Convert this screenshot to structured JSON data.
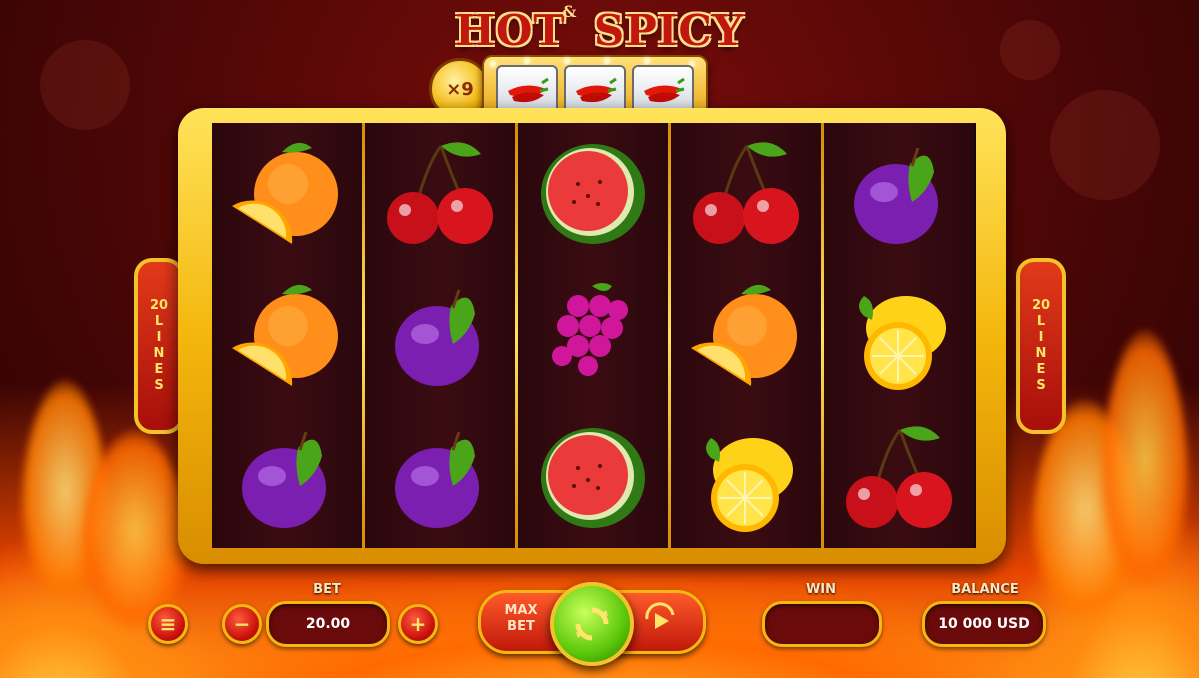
{
  "game": {
    "title_left": "HOT",
    "title_amp": "&",
    "title_right": "SPICY",
    "multiplier": "×9"
  },
  "side_tabs": {
    "left": [
      "20",
      "L",
      "I",
      "N",
      "E",
      "S"
    ],
    "right": [
      "20",
      "L",
      "I",
      "N",
      "E",
      "S"
    ]
  },
  "reels": [
    [
      "orange",
      "orange",
      "plum"
    ],
    [
      "cherry",
      "plum",
      "plum"
    ],
    [
      "watermelon",
      "grapes",
      "watermelon"
    ],
    [
      "cherry",
      "orange",
      "lemon"
    ],
    [
      "plum",
      "lemon",
      "cherry"
    ]
  ],
  "controls": {
    "menu_icon": "≡",
    "minus_label": "−",
    "plus_label": "+",
    "bet_label": "BET",
    "bet_value": "20.00",
    "max_bet_line1": "MAX",
    "max_bet_line2": "BET",
    "win_label": "WIN",
    "win_value": "",
    "balance_label": "BALANCE",
    "balance_value": "10 000 USD"
  },
  "colors": {
    "gold": "#f5b80f",
    "red": "#c0170f",
    "spin_green": "#5cc80a"
  }
}
